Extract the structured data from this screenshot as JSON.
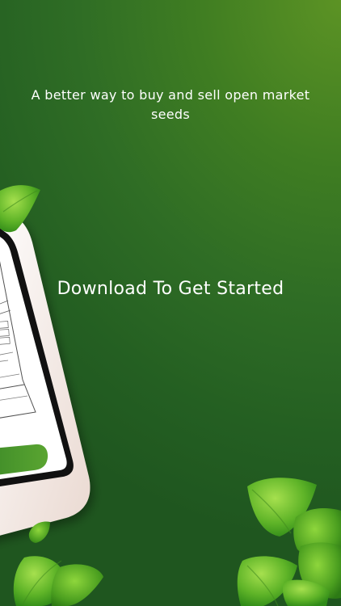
{
  "promo": {
    "tagline": "A better way to buy and sell open market seeds",
    "cta": "Download To Get Started"
  },
  "colors": {
    "background_top": "#5c9324",
    "background_bottom": "#1f561f",
    "phone_frame": "#f7f1ee",
    "leaf_light": "#8fd23a",
    "leaf_dark": "#3f9a1e",
    "button_green": "#4b8f2a"
  },
  "icons": [
    "leaf-icon"
  ]
}
